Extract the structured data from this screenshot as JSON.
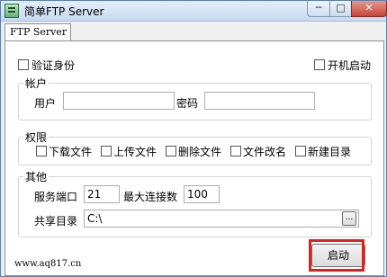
{
  "window": {
    "title": "简单FTP Server",
    "min_glyph": "─",
    "max_glyph": "□",
    "close_glyph": "✕"
  },
  "tab": {
    "label": "FTP Server"
  },
  "options": {
    "verify_identity": "验证身份",
    "autostart": "开机启动"
  },
  "account": {
    "legend": "帐户",
    "user_label": "用户",
    "user_value": "",
    "password_label": "密码",
    "password_value": ""
  },
  "permissions": {
    "legend": "权限",
    "items": [
      "下载文件",
      "上传文件",
      "删除文件",
      "文件改名",
      "新建目录"
    ]
  },
  "other": {
    "legend": "其他",
    "port_label": "服务端口",
    "port_value": "21",
    "maxconn_label": "最大连接数",
    "maxconn_value": "100",
    "share_label": "共享目录",
    "share_value": "C:\\",
    "browse_label": "..."
  },
  "footer": {
    "url": "www.aq817.cn",
    "start_label": "启动"
  }
}
